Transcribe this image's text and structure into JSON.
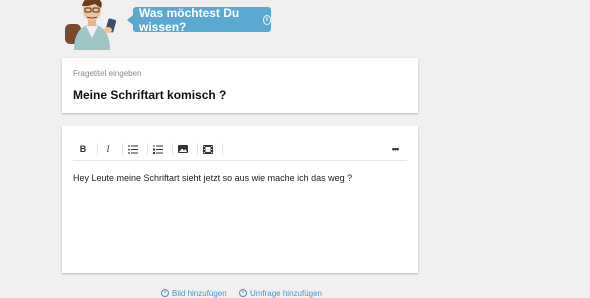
{
  "header": {
    "prompt": "Was möchtest Du wissen?",
    "info_glyph": "i"
  },
  "title_field": {
    "label": "Fragetitel eingeben",
    "value": "Meine Schriftart komisch ?"
  },
  "toolbar": {
    "bold": "B",
    "italic": "I",
    "more": "•••"
  },
  "editor": {
    "text": "Hey Leute meine Schriftart sieht jetzt so aus wie mache ich das weg ?"
  },
  "actions": {
    "add_image": "Bild hinzufügen",
    "add_poll": "Umfrage hinzufügen",
    "plus_glyph": "+"
  },
  "colors": {
    "accent": "#5aa9d0",
    "link": "#4f92c2",
    "background": "#f0f0f0"
  }
}
